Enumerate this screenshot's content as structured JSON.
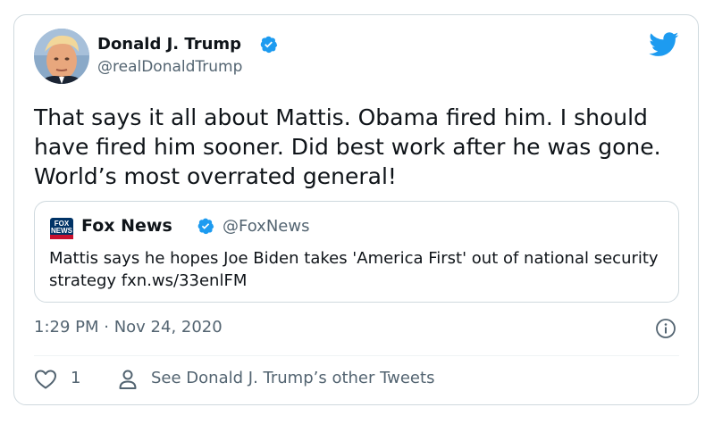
{
  "tweet": {
    "author_name": "Donald J. Trump",
    "handle": "@realDonaldTrump",
    "text": "That says it all about Mattis. Obama fired him. I should have fired him sooner. Did best work after he was gone. World’s most overrated general!",
    "timestamp": "1:29 PM · Nov 24, 2020",
    "like_count": "1",
    "other_tweets_label": "See Donald J. Trump’s other Tweets"
  },
  "quote": {
    "author_name": "Fox News",
    "handle": "@FoxNews",
    "avatar_text_line1": "FOX",
    "avatar_text_line2": "NEWS",
    "text": "Mattis says he hopes Joe Biden takes 'America First' out of national security strategy fxn.ws/33enlFM"
  },
  "icons": {
    "logo": "twitter-bird-icon",
    "verified": "verified-badge-icon",
    "info": "info-icon",
    "like": "heart-icon",
    "profile": "person-icon"
  },
  "colors": {
    "brand": "#1d9bf0",
    "secondary_text": "#536471",
    "border": "#cfd9de",
    "fox_red": "#c8102e",
    "fox_blue": "#003366"
  }
}
